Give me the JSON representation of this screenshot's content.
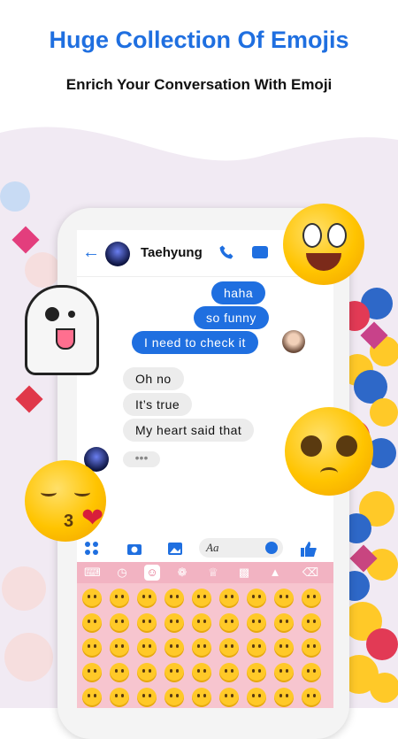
{
  "headline": "Huge Collection Of Emojis",
  "subline": "Enrich Your Conversation With Emoji",
  "chat": {
    "contact_name": "Taehyung",
    "messages_out": [
      "haha",
      "so funny",
      "I need to check it"
    ],
    "messages_in": [
      "Oh no",
      "It’s true",
      "My heart said that"
    ],
    "typing_indicator": "•••",
    "input_placeholder": "Aa"
  },
  "colors": {
    "brand_blue": "#1f6fe0",
    "keyboard_pink": "#f7c5cf",
    "emoji_yellow": "#ffc928"
  },
  "icons": [
    "back-arrow-icon",
    "phone-icon",
    "video-icon",
    "apps-icon",
    "camera-icon",
    "gallery-icon",
    "emoji-icon",
    "thumbs-up-icon",
    "keyboard-icon",
    "clock-icon",
    "smiley-icon",
    "flower-icon",
    "crown-icon",
    "car-icon",
    "triangle-icon",
    "backspace-icon"
  ]
}
